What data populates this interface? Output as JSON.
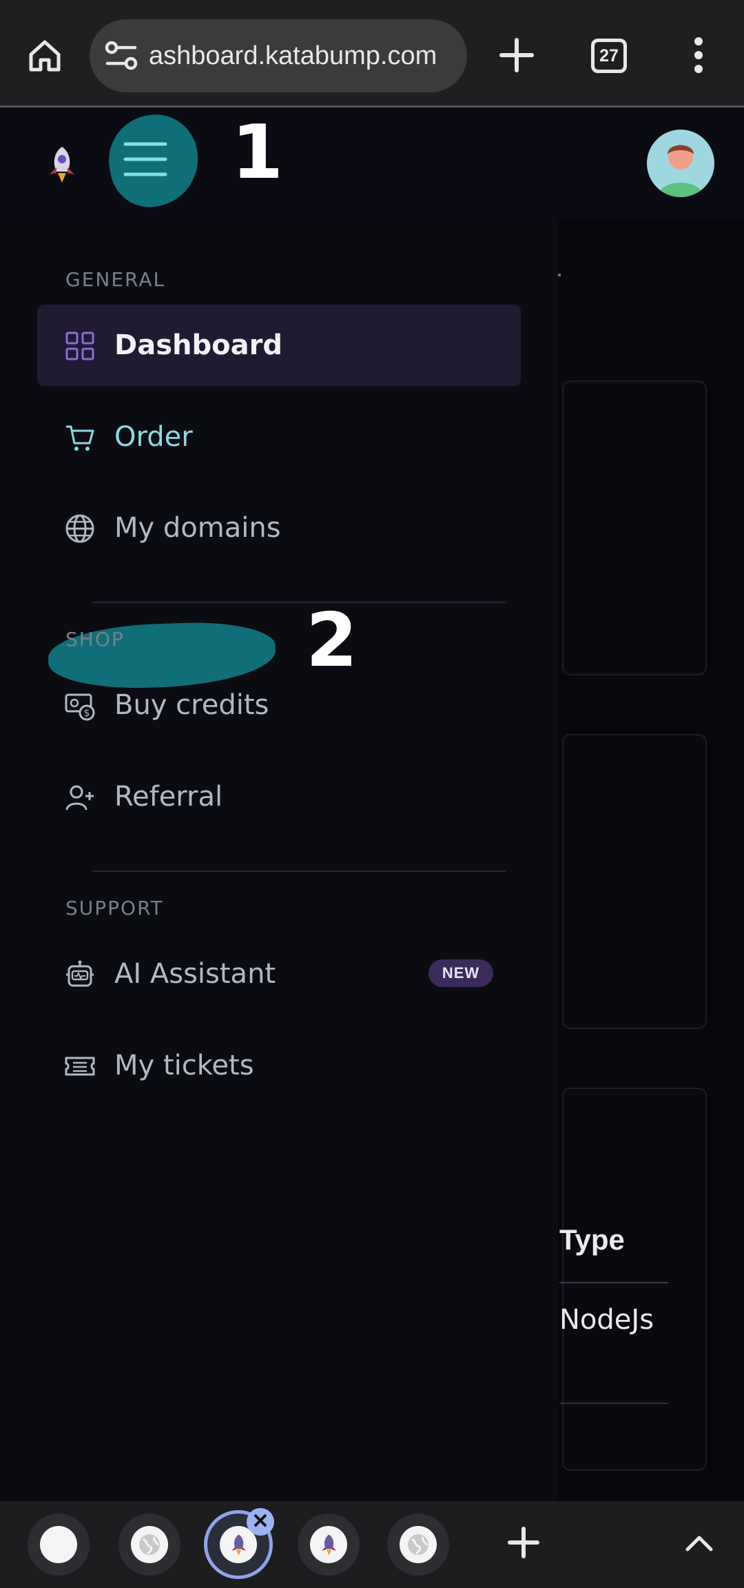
{
  "browser": {
    "url": "ashboard.katabump.com",
    "tab_count": "27"
  },
  "annotations": {
    "step1": "1",
    "step2": "2"
  },
  "sidebar": {
    "sections": [
      {
        "label": "GENERAL"
      },
      {
        "label": "SHOP"
      },
      {
        "label": "SUPPORT"
      }
    ],
    "items": [
      {
        "label": "Dashboard",
        "icon": "grid-icon",
        "active": true
      },
      {
        "label": "Order",
        "icon": "cart-icon"
      },
      {
        "label": "My domains",
        "icon": "globe-icon"
      },
      {
        "label": "Buy credits",
        "icon": "money-icon"
      },
      {
        "label": "Referral",
        "icon": "add-user-icon"
      },
      {
        "label": "AI Assistant",
        "icon": "robot-icon",
        "badge": "NEW"
      },
      {
        "label": "My tickets",
        "icon": "ticket-icon"
      }
    ]
  },
  "main": {
    "table_header": "Type",
    "table_value": "NodeJs"
  },
  "colors": {
    "highlight": "#0f6e78",
    "active_item_bg": "#201b33",
    "badge_bg": "#3a2b5c"
  }
}
